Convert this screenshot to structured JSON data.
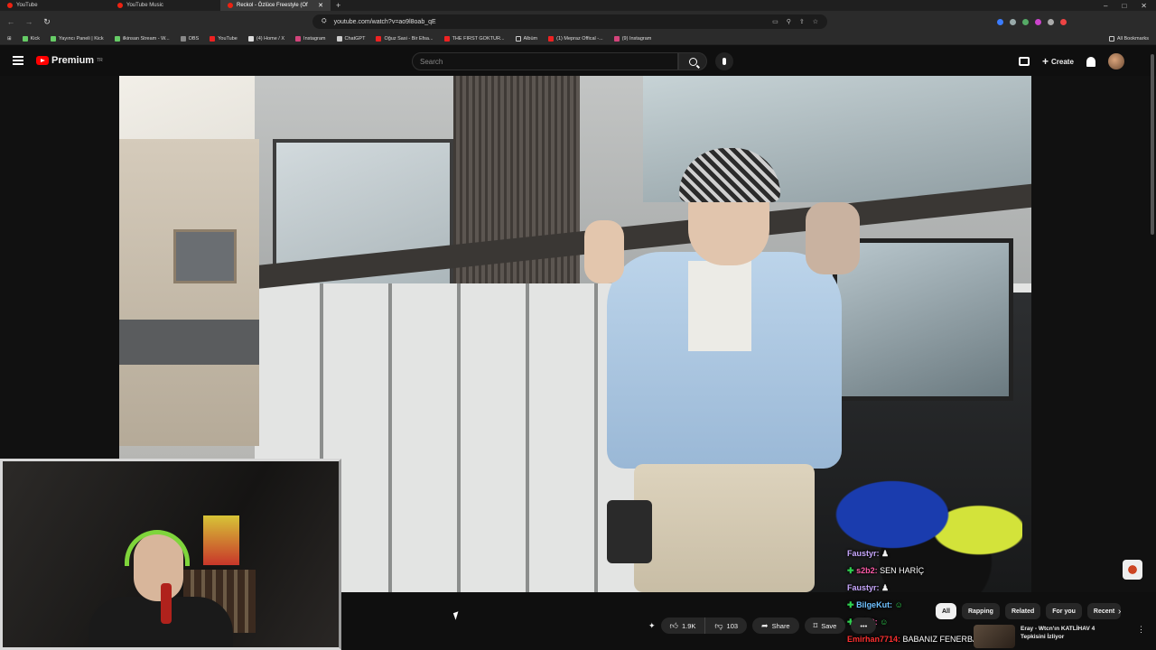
{
  "browser": {
    "tabs": [
      {
        "label": "YouTube"
      },
      {
        "label": "YouTube Music"
      },
      {
        "label": "Reckol - Özlüce Freestyle (Of"
      }
    ],
    "url": "youtube.com/watch?v=ao9l8oab_qE",
    "bookmarks": [
      {
        "label": "Kick"
      },
      {
        "label": "Yayıncı Paneli | Kick"
      },
      {
        "label": "ilkinsan Stream - W..."
      },
      {
        "label": "OBS"
      },
      {
        "label": "YouTube"
      },
      {
        "label": "(4) Home / X"
      },
      {
        "label": "Instagram"
      },
      {
        "label": "ChatGPT"
      },
      {
        "label": "Oğuz Sasi - Bir Efsa..."
      },
      {
        "label": "THE FIRST GOKTUR..."
      },
      {
        "label": "Albüm"
      },
      {
        "label": "(1) Mepraz Offical -..."
      },
      {
        "label": "(9) Instagram"
      }
    ],
    "all_bookmarks": "All Bookmarks"
  },
  "youtube": {
    "logo_text": "Premium",
    "region": "TR",
    "search_placeholder": "Search",
    "create_label": "Create"
  },
  "chat": [
    {
      "user": "Faustyr:",
      "text": "",
      "color": "#c9a9ff"
    },
    {
      "user": "s2b2:",
      "text": "SEN HARİÇ",
      "color": "#ff5aa8"
    },
    {
      "user": "Faustyr:",
      "text": "",
      "color": "#c9a9ff"
    },
    {
      "user": "BilgeKut:",
      "text": "",
      "color": "#6ec1ff"
    },
    {
      "user": "s2b2:",
      "text": "",
      "color": "#ff5aa8"
    },
    {
      "user": "Emirhan7714:",
      "text": "BABANIZ FENERBAHCE",
      "color": "#ff3030"
    }
  ],
  "actions": {
    "likes": "1.9K",
    "dislikes": "103",
    "share": "Share",
    "save": "Save"
  },
  "chips": [
    "All",
    "Rapping",
    "Related",
    "For you",
    "Recent"
  ],
  "recommendation": {
    "title": "Eray - Wtcn'ın KATLİHAV 4 Tepkisini İzliyor"
  }
}
